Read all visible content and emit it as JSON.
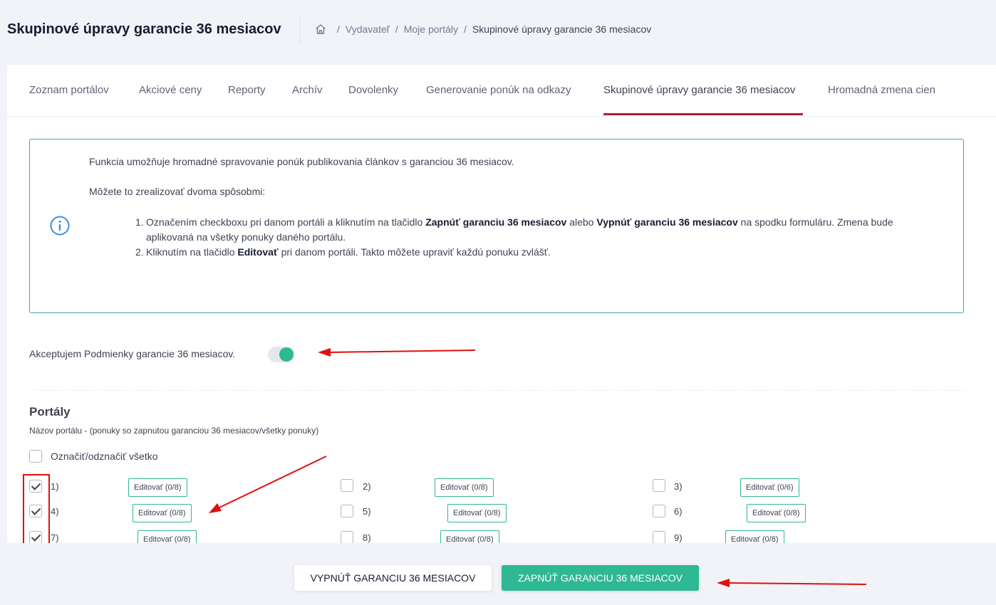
{
  "header": {
    "title": "Skupinové úpravy garancie 36 mesiacov",
    "breadcrumb": [
      "Vydavateľ",
      "Moje portály",
      "Skupinové úpravy garancie 36 mesiacov"
    ],
    "separator": "/"
  },
  "tabs": [
    {
      "label": "Zoznam portálov"
    },
    {
      "label": "Akciové ceny"
    },
    {
      "label": "Reporty"
    },
    {
      "label": "Archív"
    },
    {
      "label": "Dovolenky"
    },
    {
      "label": "Generovanie ponúk na odkazy"
    },
    {
      "label": "Skupinové úpravy garancie 36 mesiacov",
      "active": true
    },
    {
      "label": "Hromadná zmena cien"
    }
  ],
  "info": {
    "icon": "info-icon",
    "paragraph1": "Funkcia umožňuje hromadné spravovanie ponúk publikovania článkov s garanciou 36 mesiacov.",
    "paragraph2": "Môžete to zrealizovať dvoma spôsobmi:",
    "list": [
      {
        "num": "1.",
        "t1": "Označením checkboxu pri danom portáli a kliknutím na tlačidlo ",
        "b1": "Zapnúť garanciu 36 mesiacov",
        "t2": " alebo ",
        "b2": "Vypnúť garanciu 36 mesiacov",
        "t3": " na spodku formuláru. Zmena bude aplikovaná na všetky ponuky daného portálu."
      },
      {
        "num": "2.",
        "t1": "Kliknutím na tlačidlo ",
        "b1": "Editovať",
        "t2": " pri danom portáli. Takto môžete upraviť každú ponuku zvlášť."
      }
    ]
  },
  "accept": {
    "label": "Akceptujem Podmienky garancie 36 mesiacov.",
    "enabled": true
  },
  "portals": {
    "title": "Portály",
    "subtitle": "Názov portálu - (ponuky so zapnutou garanciou 36 mesiacov/všetky ponuky)",
    "select_all_label": "Označiť/odznačiť všetko",
    "items": [
      {
        "num": "1)",
        "checked": true,
        "edit_label": "Editovať (0/8)"
      },
      {
        "num": "2)",
        "checked": false,
        "edit_label": "Editovať (0/8)"
      },
      {
        "num": "3)",
        "checked": false,
        "edit_label": "Editovať (0/6)"
      },
      {
        "num": "4)",
        "checked": true,
        "edit_label": "Editovať (0/8)"
      },
      {
        "num": "5)",
        "checked": false,
        "edit_label": "Editovať (0/8)"
      },
      {
        "num": "6)",
        "checked": false,
        "edit_label": "Editovať (0/8)"
      },
      {
        "num": "7)",
        "checked": true,
        "edit_label": "Editovať (0/8)"
      },
      {
        "num": "8)",
        "checked": false,
        "edit_label": "Editovať (0/8)"
      },
      {
        "num": "9)",
        "checked": false,
        "edit_label": "Editovať (0/8)"
      }
    ]
  },
  "footer": {
    "disable_label": "VYPNÚŤ GARANCIU 36 MESIACOV",
    "enable_label": "ZAPNÚŤ GARANCIU 36 MESIACOV"
  },
  "colors": {
    "accent": "#2fb894",
    "tab_active": "#b01c3b",
    "info_border": "#3fa0c0",
    "annotation": "#e01010"
  }
}
